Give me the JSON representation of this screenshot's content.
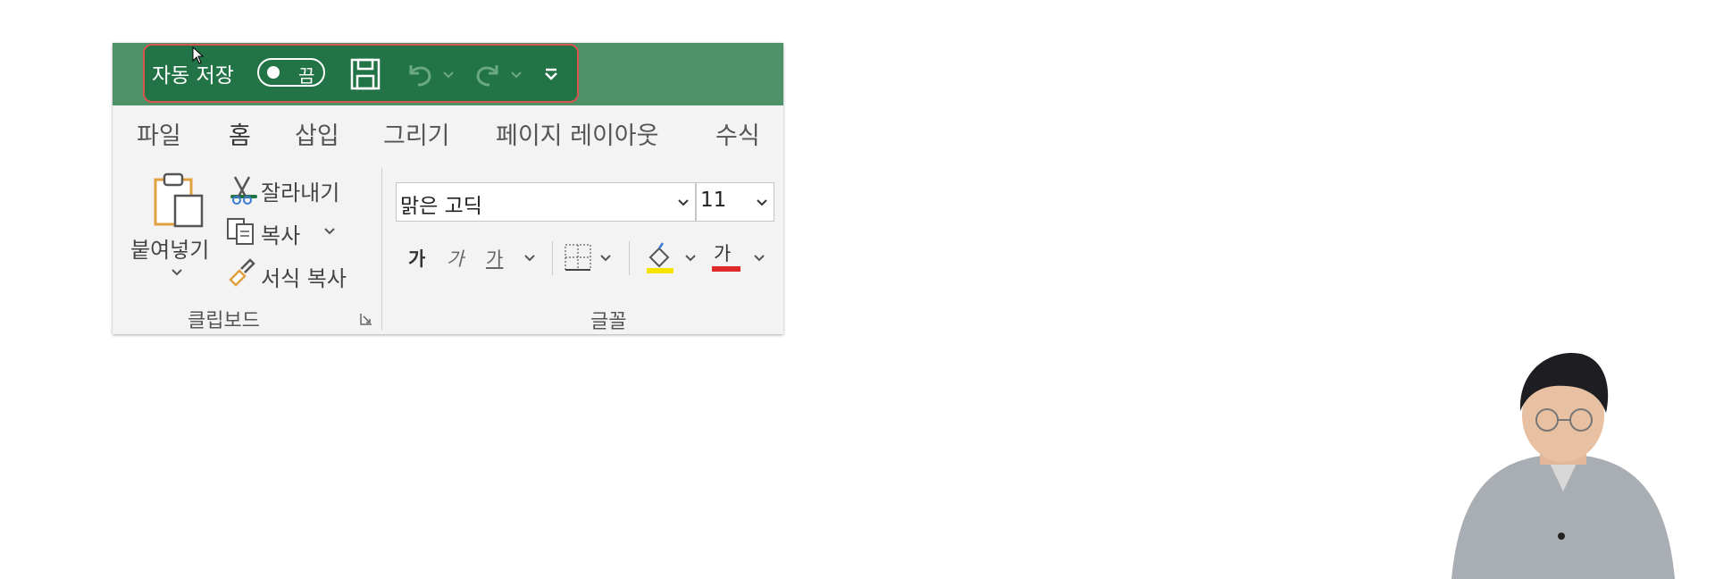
{
  "qat": {
    "autosave_label": "자동 저장",
    "autosave_state": "끔",
    "save_icon": "save-icon",
    "undo_icon": "undo-icon",
    "redo_icon": "redo-icon",
    "customize_icon": "customize-qat-icon"
  },
  "tabs": [
    {
      "label": "파일"
    },
    {
      "label": "홈",
      "active": true
    },
    {
      "label": "삽입"
    },
    {
      "label": "그리기"
    },
    {
      "label": "페이지 레이아웃"
    },
    {
      "label": "수식"
    }
  ],
  "clipboard": {
    "paste_label": "붙여넣기",
    "cut_label": "잘라내기",
    "copy_label": "복사",
    "format_painter_label": "서식 복사",
    "group_label": "클립보드"
  },
  "font": {
    "font_name": "맑은 고딕",
    "font_size": "11",
    "bold_glyph": "가",
    "italic_glyph": "가",
    "underline_glyph": "가",
    "font_color_glyph": "가",
    "group_label": "글꼴"
  },
  "colors": {
    "title_green": "#4f9269",
    "qat_green": "#227447",
    "highlight_annotation": "#d9534f",
    "fill_yellow": "#f5e400",
    "font_red": "#e02a2a"
  }
}
